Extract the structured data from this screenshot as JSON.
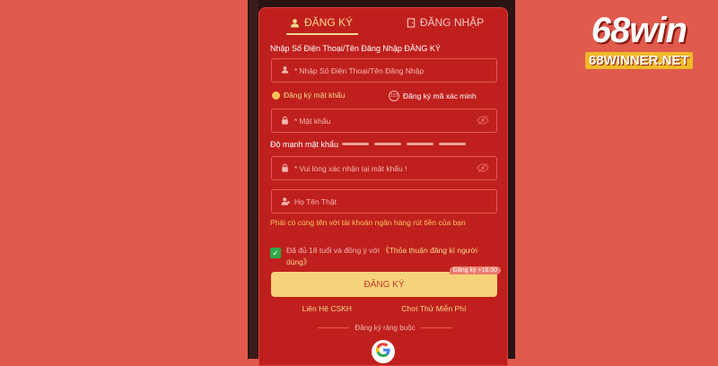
{
  "tabs": {
    "register": "ĐĂNG KÝ",
    "login": "ĐĂNG NHẬP"
  },
  "form": {
    "phone_label": "Nhập Số Điện Thoại/Tên Đăng Nhập ĐĂNG KÝ",
    "phone_placeholder": "Nhập Số Điện Thoại/Tên Đăng Nhập",
    "option_password": "Đăng ký mật khẩu",
    "option_code": "Đăng ký mã xác minh",
    "code_badge": "123",
    "password_placeholder": "Mật khẩu",
    "strength_label": "Độ mạnh mật khẩu",
    "confirm_placeholder": "Vui lòng xác nhận lại mật khẩu !",
    "fullname_placeholder": "Họ Tên Thật",
    "name_warning": "Phải có cùng tên với tài khoản ngân hàng rút tiền của bạn",
    "agree_text": "Đã đủ 18 tuổi và đồng ý với",
    "agree_link": "《Thỏa thuận đăng kí người dùng》",
    "submit_label": "ĐĂNG KÝ",
    "submit_badge": "Đăng ký +18.00",
    "required_mark": "*"
  },
  "footer": {
    "contact": "Liên Hệ CSKH",
    "trial": "Chơi Thử Miễn Phí",
    "divider_text": "Đăng ký ràng buộc"
  },
  "brand": {
    "logo": "68win",
    "site": "68WINNER.NET"
  },
  "colors": {
    "panel": "#c0201d",
    "accent": "#f6d98c",
    "button": "#f6d27a",
    "background": "#e05a4e"
  },
  "icons": {
    "register_tab": "user-icon",
    "login_tab": "door-icon",
    "eye": "eye-off-icon",
    "google": "google-icon"
  }
}
